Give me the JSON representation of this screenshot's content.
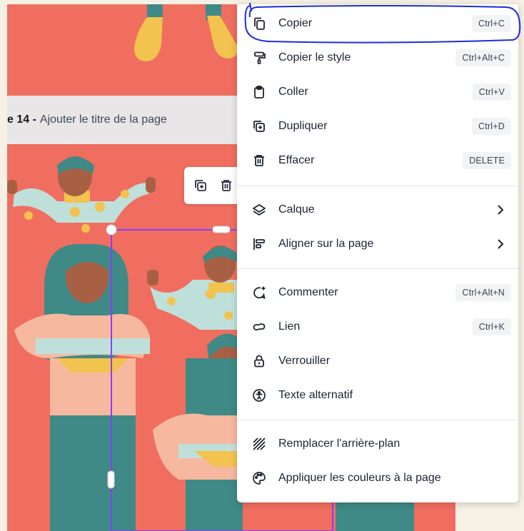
{
  "page_header": {
    "number": "e 14 -",
    "title": "Ajouter le titre de la page"
  },
  "floating_toolbar": {
    "icons": [
      "duplicate-icon",
      "trash-icon"
    ]
  },
  "context_menu": {
    "items": [
      {
        "label": "Copier",
        "shortcut": "Ctrl+C",
        "icon": "copy-icon"
      },
      {
        "label": "Copier le style",
        "shortcut": "Ctrl+Alt+C",
        "icon": "paint-roller-icon"
      },
      {
        "label": "Coller",
        "shortcut": "Ctrl+V",
        "icon": "clipboard-icon"
      },
      {
        "label": "Dupliquer",
        "shortcut": "Ctrl+D",
        "icon": "duplicate-icon"
      },
      {
        "label": "Effacer",
        "shortcut": "DELETE",
        "icon": "trash-icon"
      },
      {
        "label": "Calque",
        "icon": "layers-icon",
        "submenu": true
      },
      {
        "label": "Aligner sur la page",
        "icon": "align-icon",
        "submenu": true
      },
      {
        "label": "Commenter",
        "shortcut": "Ctrl+Alt+N",
        "icon": "comment-icon"
      },
      {
        "label": "Lien",
        "shortcut": "Ctrl+K",
        "icon": "link-icon"
      },
      {
        "label": "Verrouiller",
        "icon": "lock-icon"
      },
      {
        "label": "Texte alternatif",
        "icon": "accessibility-icon"
      },
      {
        "label": "Remplacer l'arrière-plan",
        "icon": "background-pattern-icon"
      },
      {
        "label": "Appliquer les couleurs à la page",
        "icon": "palette-icon"
      }
    ]
  },
  "colors": {
    "page_background": "#f06e5f",
    "selection": "#8b3dff",
    "annotation": "#1a2fd6",
    "figure_teal": "#3f8a86",
    "figure_skin": "#f7b8a0",
    "figure_yellow": "#f2c34e"
  }
}
